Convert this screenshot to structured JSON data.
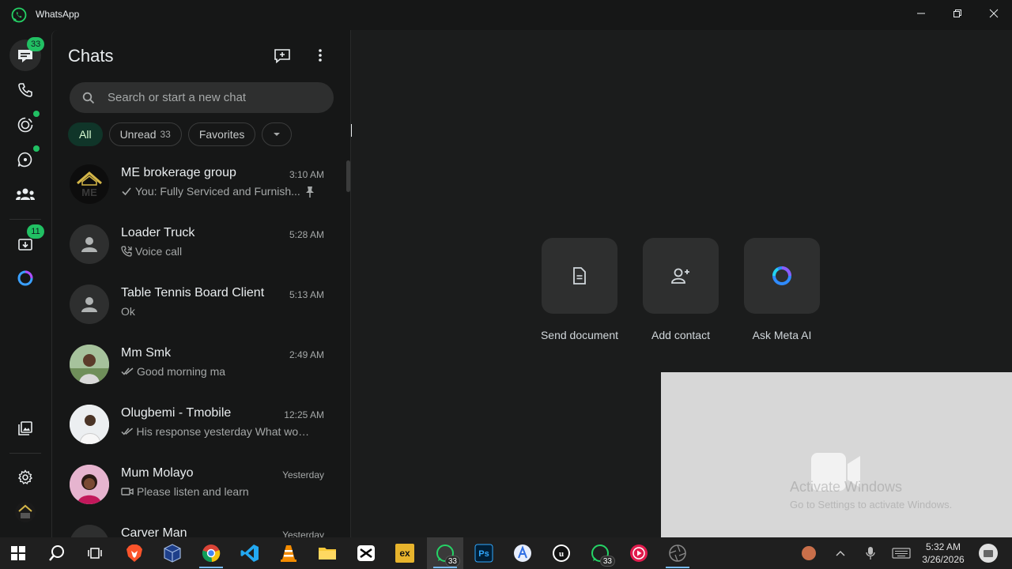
{
  "window": {
    "title": "WhatsApp"
  },
  "rail": {
    "chats_badge": "33",
    "archived_badge": "11"
  },
  "chatlist": {
    "title": "Chats",
    "search_placeholder": "Search or start a new chat",
    "filters": [
      {
        "label": "All",
        "count": ""
      },
      {
        "label": "Unread",
        "count": "33"
      },
      {
        "label": "Favorites",
        "count": ""
      }
    ],
    "chats": [
      {
        "name": "ME brokerage group",
        "time": "3:10 AM",
        "preview": "You: Fully Serviced  and Furnish...",
        "status": "sent",
        "pinned": true,
        "avatar": "logo"
      },
      {
        "name": "Loader Truck",
        "time": "5:28 AM",
        "preview": "Voice call",
        "status": "call",
        "pinned": false,
        "avatar": "default"
      },
      {
        "name": "Table Tennis Board Client",
        "time": "5:13 AM",
        "preview": "Ok",
        "status": "none",
        "pinned": false,
        "avatar": "default"
      },
      {
        "name": "Mm Smk",
        "time": "2:49 AM",
        "preview": "Good morning ma",
        "status": "read",
        "pinned": false,
        "avatar": "photo-green"
      },
      {
        "name": "Olugbemi - Tmobile",
        "time": "12:25 AM",
        "preview": "His response yesterday  What woul...",
        "status": "read",
        "pinned": false,
        "avatar": "photo-light"
      },
      {
        "name": "Mum Molayo",
        "time": "Yesterday",
        "preview": "Please listen and learn",
        "status": "video",
        "pinned": false,
        "avatar": "photo-pink"
      },
      {
        "name": "Carver Man",
        "time": "Yesterday",
        "preview": "",
        "status": "none",
        "pinned": false,
        "avatar": "default"
      }
    ]
  },
  "main": {
    "actions": [
      {
        "label": "Send document",
        "icon": "document-icon"
      },
      {
        "label": "Add contact",
        "icon": "add-contact-icon"
      },
      {
        "label": "Ask Meta AI",
        "icon": "meta-ai-icon"
      }
    ],
    "watermark_title": "Activate Windows",
    "watermark_sub": "Go to Settings to activate Windows."
  },
  "taskbar": {
    "whatsapp_badge": "33",
    "whatsapp2_badge": "33",
    "time": "5:32 AM",
    "date": "3/26/2026"
  },
  "colors": {
    "accent": "#21c063",
    "background": "#161717",
    "panel": "#1b1c1c"
  }
}
